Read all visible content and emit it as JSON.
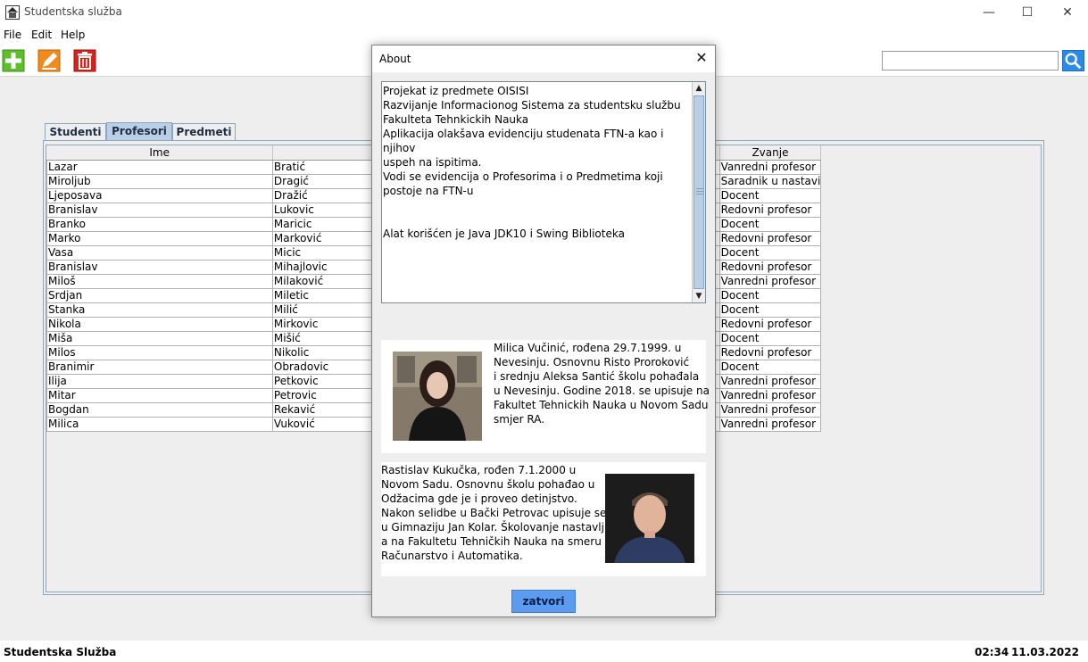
{
  "window": {
    "title": "Studentska služba",
    "minimize_icon": "minimize-icon",
    "maximize_icon": "maximize-icon",
    "close_icon": "close-icon"
  },
  "menu": {
    "file": "File",
    "edit": "Edit",
    "help": "Help"
  },
  "toolbar": {
    "add_icon": "plus-icon",
    "edit_icon": "pencil-icon",
    "delete_icon": "trash-icon",
    "search_value": "",
    "search_icon": "magnifier-icon"
  },
  "tabs": [
    {
      "label": "Studenti",
      "active": false
    },
    {
      "label": "Profesori",
      "active": true
    },
    {
      "label": "Predmeti",
      "active": false
    }
  ],
  "table": {
    "columns": [
      "Ime",
      "",
      "",
      "",
      "Zvanje"
    ],
    "rows": [
      [
        "Lazar",
        "Bratić",
        "Vanredni profesor"
      ],
      [
        "Miroljub",
        "Dragić",
        "Saradnik u nastavi"
      ],
      [
        "Ljeposava",
        "Dražić",
        "Docent"
      ],
      [
        "Branislav",
        "Lukovic",
        "Redovni profesor"
      ],
      [
        "Branko",
        "Maricic",
        "Docent"
      ],
      [
        "Marko",
        "Marković",
        "Redovni profesor"
      ],
      [
        "Vasa",
        "Micic",
        "Docent"
      ],
      [
        "Branislav",
        "Mihajlovic",
        "Redovni profesor"
      ],
      [
        "Miloš",
        "Milaković",
        "Vanredni profesor"
      ],
      [
        "Srdjan",
        "Miletic",
        "Docent"
      ],
      [
        "Stanka",
        "Milić",
        "Docent"
      ],
      [
        "Nikola",
        "Mirkovic",
        "Redovni profesor"
      ],
      [
        "Miša",
        "Mišić",
        "Docent"
      ],
      [
        "Milos",
        "Nikolic",
        "Redovni profesor"
      ],
      [
        "Branimir",
        "Obradovic",
        "Docent"
      ],
      [
        "Ilija",
        "Petkovic",
        "Vanredni profesor"
      ],
      [
        "Mitar",
        "Petrovic",
        "Vanredni profesor"
      ],
      [
        "Bogdan",
        "Rekavić",
        "Vanredni profesor"
      ],
      [
        "Milica",
        "Vuković",
        "Vanredni profesor"
      ]
    ]
  },
  "status": {
    "app_name": "Studentska Služba",
    "time": "02:34",
    "date": "11.03.2022"
  },
  "about": {
    "title": "About",
    "lines": [
      "Projekat iz predmete OISISI",
      "Razvijanje Informacionog Sistema za studentsku službu",
      "Fakulteta Tehnkickih Nauka",
      "Aplikacija olakšava evidenciju studenata FTN-a kao i njihov",
      "uspeh na ispitima.",
      "Vodi se evidencija o Profesorima i o Predmetima koji",
      "postoje na FTN-u",
      "",
      "",
      "Alat korišćen je Java JDK10 i Swing Biblioteka"
    ],
    "bio1_lines": [
      "Milica Vučinić, rođena 29.7.1999. u",
      "Nevesinju. Osnovnu Risto Proroković",
      "i srednju Aleksa Santić školu pohađala",
      "u Nevesinju. Godine 2018. se upisuje na",
      "Fakultet Tehnickih Nauka u Novom Sadu",
      "smjer RA."
    ],
    "bio2_lines": [
      "Rastislav Kukučka, rođen 7.1.2000 u",
      "Novom Sadu. Osnovnu školu pohađao u",
      "Odžacima gde je i proveo detinjstvo.",
      "Nakon selidbe u Bački Petrovac upisuje se",
      "u Gimnaziju Jan Kolar. Školovanje nastavlj",
      "a na Fakultetu Tehničkih Nauka na smeru",
      "Računarstvo i Automatika."
    ],
    "button": "zatvori"
  }
}
